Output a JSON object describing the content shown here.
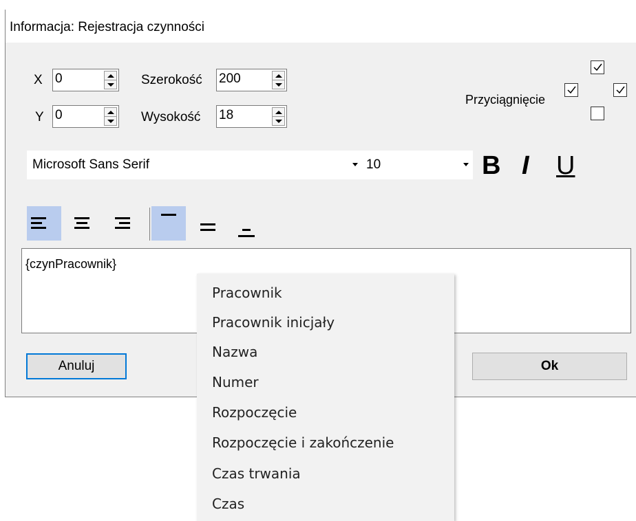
{
  "window": {
    "title": "Informacja: Rejestracja czynności"
  },
  "position": {
    "x_label": "X",
    "x_value": "0",
    "y_label": "Y",
    "y_value": "0",
    "width_label": "Szerokość",
    "width_value": "200",
    "height_label": "Wysokość",
    "height_value": "18"
  },
  "snap": {
    "label": "Przyciągnięcie",
    "top": true,
    "left": true,
    "right": true,
    "bottom": false
  },
  "font": {
    "family": "Microsoft Sans Serif",
    "size": "10",
    "bold_label": "B",
    "italic_label": "I",
    "underline_label": "U"
  },
  "alignment": {
    "horizontal": [
      "left",
      "center",
      "right"
    ],
    "horizontal_selected": "left",
    "vertical": [
      "top",
      "middle",
      "bottom"
    ],
    "vertical_selected": "top"
  },
  "content": {
    "text": "{czynPracownik}"
  },
  "buttons": {
    "cancel_label": "Anuluj",
    "ok_label": "Ok"
  },
  "context_menu": {
    "items": [
      "Pracownik",
      "Pracownik inicjały",
      "Nazwa",
      "Numer",
      "Rozpoczęcie",
      "Rozpoczęcie i zakończenie",
      "Czas trwania",
      "Czas"
    ]
  }
}
